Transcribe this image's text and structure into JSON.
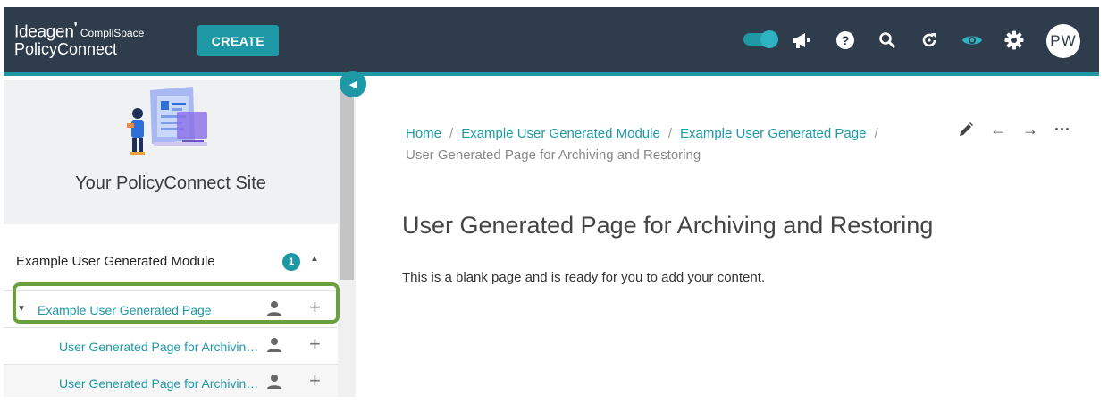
{
  "header": {
    "logo_brand": "Ideagen",
    "logo_sub": "CompliSpace",
    "logo_product": "PolicyConnect",
    "create_label": "CREATE",
    "avatar_initials": "PW",
    "icons": [
      "toggle-switch",
      "megaphone-icon",
      "help-icon",
      "search-icon",
      "refresh-icon",
      "eye-icon",
      "gear-icon"
    ]
  },
  "sidebar": {
    "site_title": "Your PolicyConnect Site",
    "module": {
      "label": "Example User Generated Module",
      "badge": "1"
    },
    "tree": [
      {
        "label": "Example User Generated Page"
      },
      {
        "label": "User Generated Page for Archivin…"
      },
      {
        "label": "User Generated Page for Archivin…"
      }
    ]
  },
  "breadcrumb": {
    "home": "Home",
    "module": "Example User Generated Module",
    "page": "Example User Generated Page",
    "current": "User Generated Page for Archiving and Restoring"
  },
  "page": {
    "title": "User Generated Page for Archiving and Restoring",
    "body": "This is a blank page and is ready for you to add your content."
  },
  "colors": {
    "topbar": "#2e3c4b",
    "accent": "#1f98a6",
    "highlight": "#6aa13e"
  }
}
